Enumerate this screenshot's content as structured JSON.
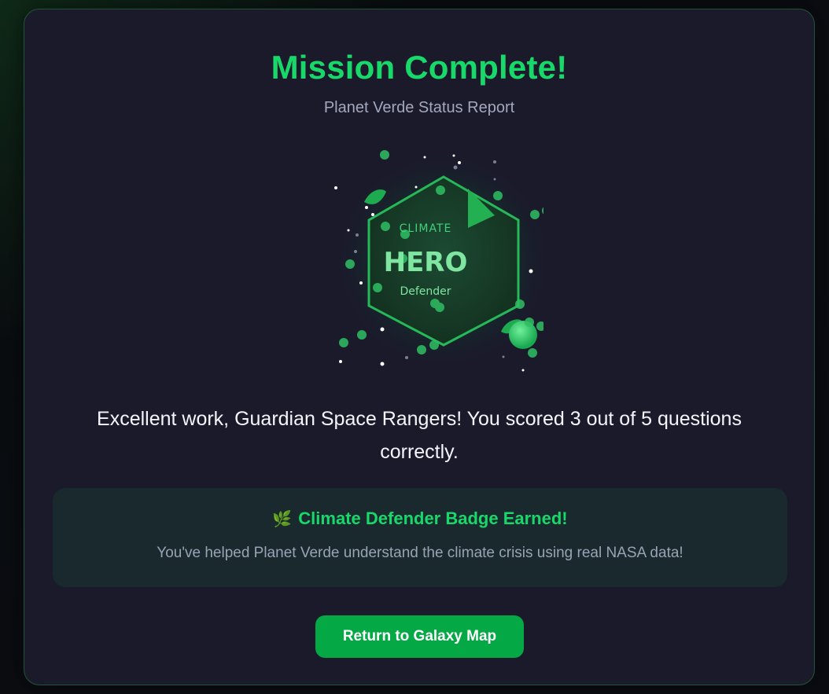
{
  "header": {
    "title": "Mission Complete!",
    "subtitle": "Planet Verde Status Report"
  },
  "badge": {
    "line1": "CLIMATE",
    "line2": "HERO",
    "line3": "Defender",
    "icon": "hexagon-badge-icon"
  },
  "result": {
    "message": "Excellent work, Guardian Space Rangers! You scored 3 out of 5 questions correctly.",
    "score": 3,
    "total": 5
  },
  "earned": {
    "icon": "leaf-icon",
    "icon_glyph": "🌿",
    "title": "Climate Defender Badge Earned!",
    "description": "You've helped Planet Verde understand the climate crisis using real NASA data!"
  },
  "actions": {
    "return_label": "Return to Galaxy Map"
  },
  "colors": {
    "accent": "#19d86a",
    "button": "#04a845",
    "card_bg": "#1a1a2b"
  }
}
